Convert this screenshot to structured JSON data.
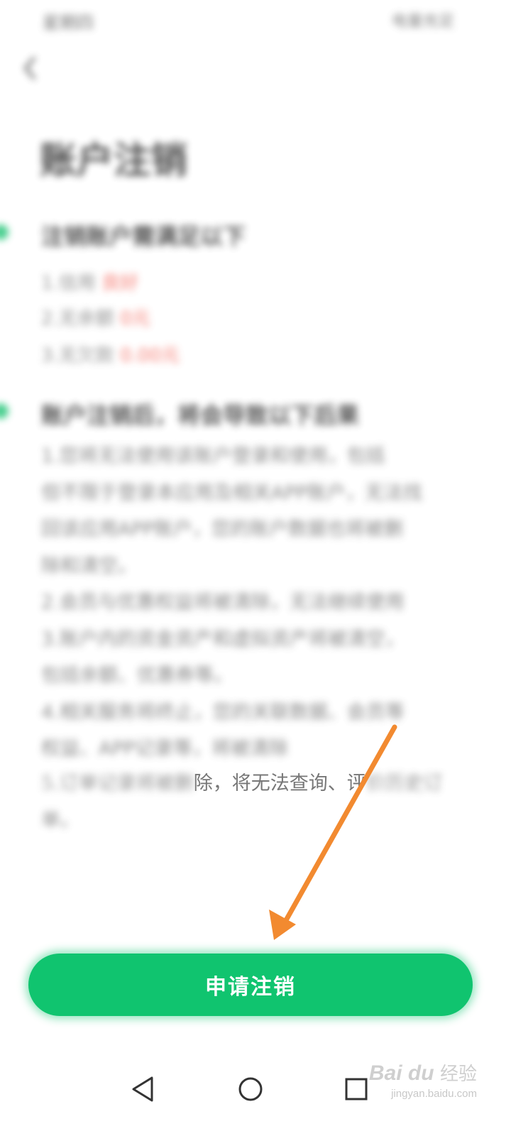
{
  "status_bar": {
    "left_text": "星期四 ",
    "right_text": "电量充足"
  },
  "header": {
    "title": "账户注销"
  },
  "conditions": {
    "title": "注销账户需满足以下",
    "items": [
      {
        "label": "1.信用 ",
        "value": "良好"
      },
      {
        "label": "2.无余额 ",
        "value": "0元"
      },
      {
        "label": "3.无欠款 ",
        "value": "0.00元"
      }
    ]
  },
  "notice": {
    "title": "账户注销后，将会导致以下后果",
    "lines": [
      "1.您将无法使用该账户登录和使用，包括",
      "但不限于登录本应用及相关APP账户，无法找",
      "回该应用APP账户，您的账户数据也将被删",
      "除和清空。",
      "2.会员与优惠权益将被清除，无法继续使用",
      "3.账户内的资金资产和虚拟资产将被清空，",
      "包括余额、优惠券等。",
      "4.相关服务将终止，您的关联数据、会员等",
      "权益、APP记录等，将被清除"
    ],
    "last_line_blur": "5.订单记录将被删",
    "last_line_clear": "除，将无法查询、评",
    "last_line_tail": "价历史订",
    "last_line_continuation": "单。"
  },
  "footer": {
    "apply_button_label": "申请注销"
  },
  "nav": {
    "back": "back-icon",
    "home": "home-icon",
    "recents": "recents-icon"
  },
  "watermark": {
    "logo_text": "Bai du",
    "cn_text": "经验",
    "url": "jingyan.baidu.com"
  },
  "colors": {
    "accent": "#10c46f",
    "highlight": "#f25b4f",
    "annotation_arrow": "#f28a30"
  }
}
